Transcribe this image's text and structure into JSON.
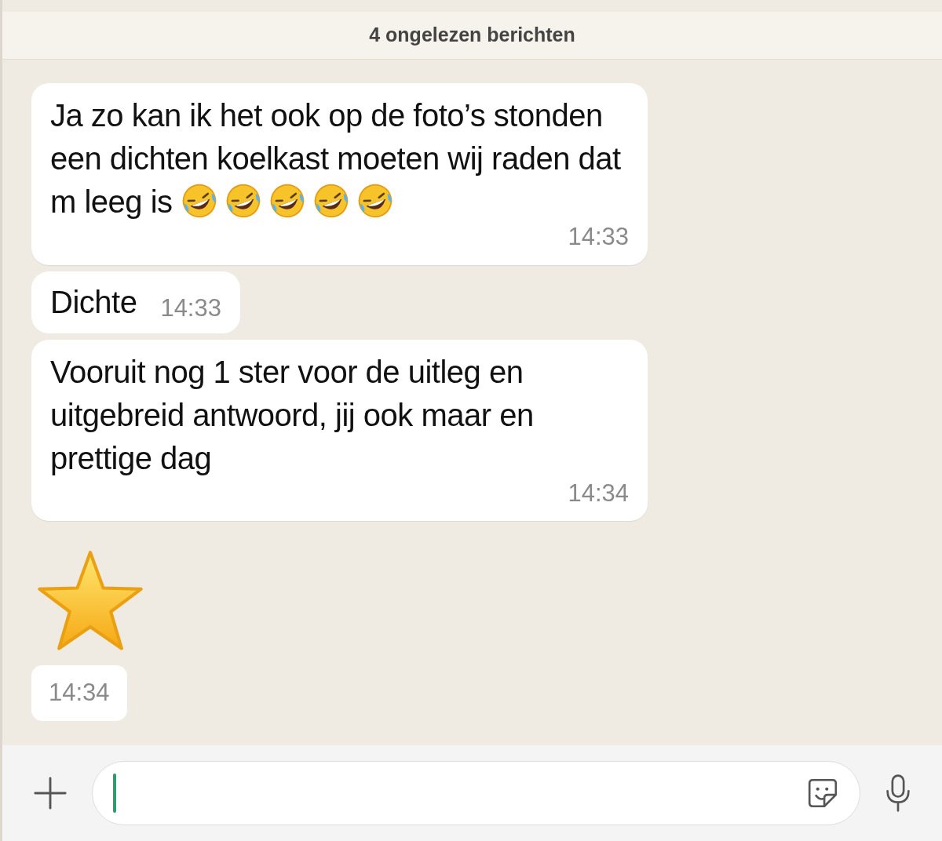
{
  "unread_banner": "4 ongelezen berichten",
  "messages": [
    {
      "kind": "text",
      "text": "Ja zo kan ik het ook op de foto’s stonden een dichten koelkast moeten wij raden dat m leeg is",
      "emojis": [
        {
          "kind": "laughing"
        },
        {
          "kind": "laughing"
        },
        {
          "kind": "laughing"
        },
        {
          "kind": "laughing"
        },
        {
          "kind": "laughing"
        }
      ],
      "time": "14:33"
    },
    {
      "kind": "inline",
      "text": "Dichte",
      "time": "14:33"
    },
    {
      "kind": "text",
      "text": "Vooruit nog 1 ster voor de uitleg en uitgebreid antwoord, jij ook maar en prettige dag",
      "time": "14:34"
    },
    {
      "kind": "star",
      "time": "14:34"
    }
  ],
  "composer": {
    "focused": true
  }
}
